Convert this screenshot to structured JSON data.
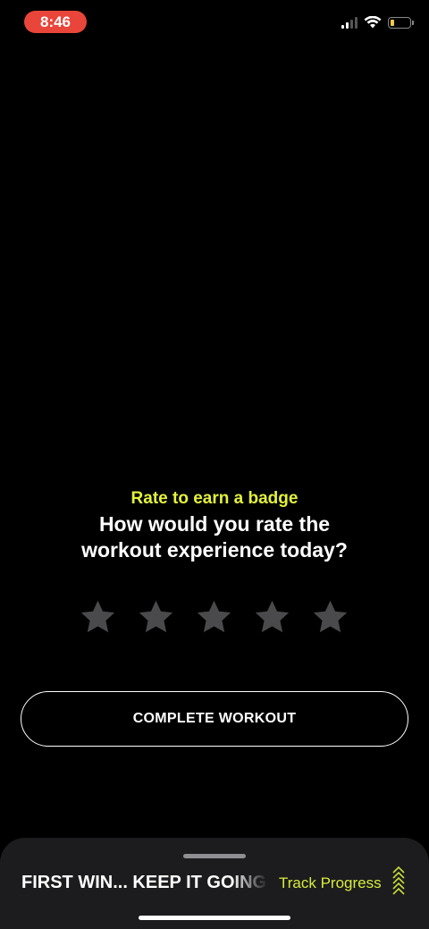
{
  "status_bar": {
    "time": "8:46",
    "signal_icon": "cellular-signal-icon",
    "wifi_icon": "wifi-icon",
    "battery_icon": "battery-low-icon",
    "time_pill_color": "#e9453a"
  },
  "rating": {
    "badge_prompt": "Rate to earn a badge",
    "question": "How would you rate the workout experience today?",
    "stars_max": 5,
    "stars_selected": 0,
    "star_icon": "star-icon",
    "accent_color": "#e3f23a"
  },
  "complete_button": {
    "label": "COMPLETE WORKOUT"
  },
  "bottom_sheet": {
    "headline": "FIRST WIN... KEEP IT GOING",
    "track_progress_label": "Track Progress",
    "expand_icon": "triple-chevron-up-icon"
  }
}
